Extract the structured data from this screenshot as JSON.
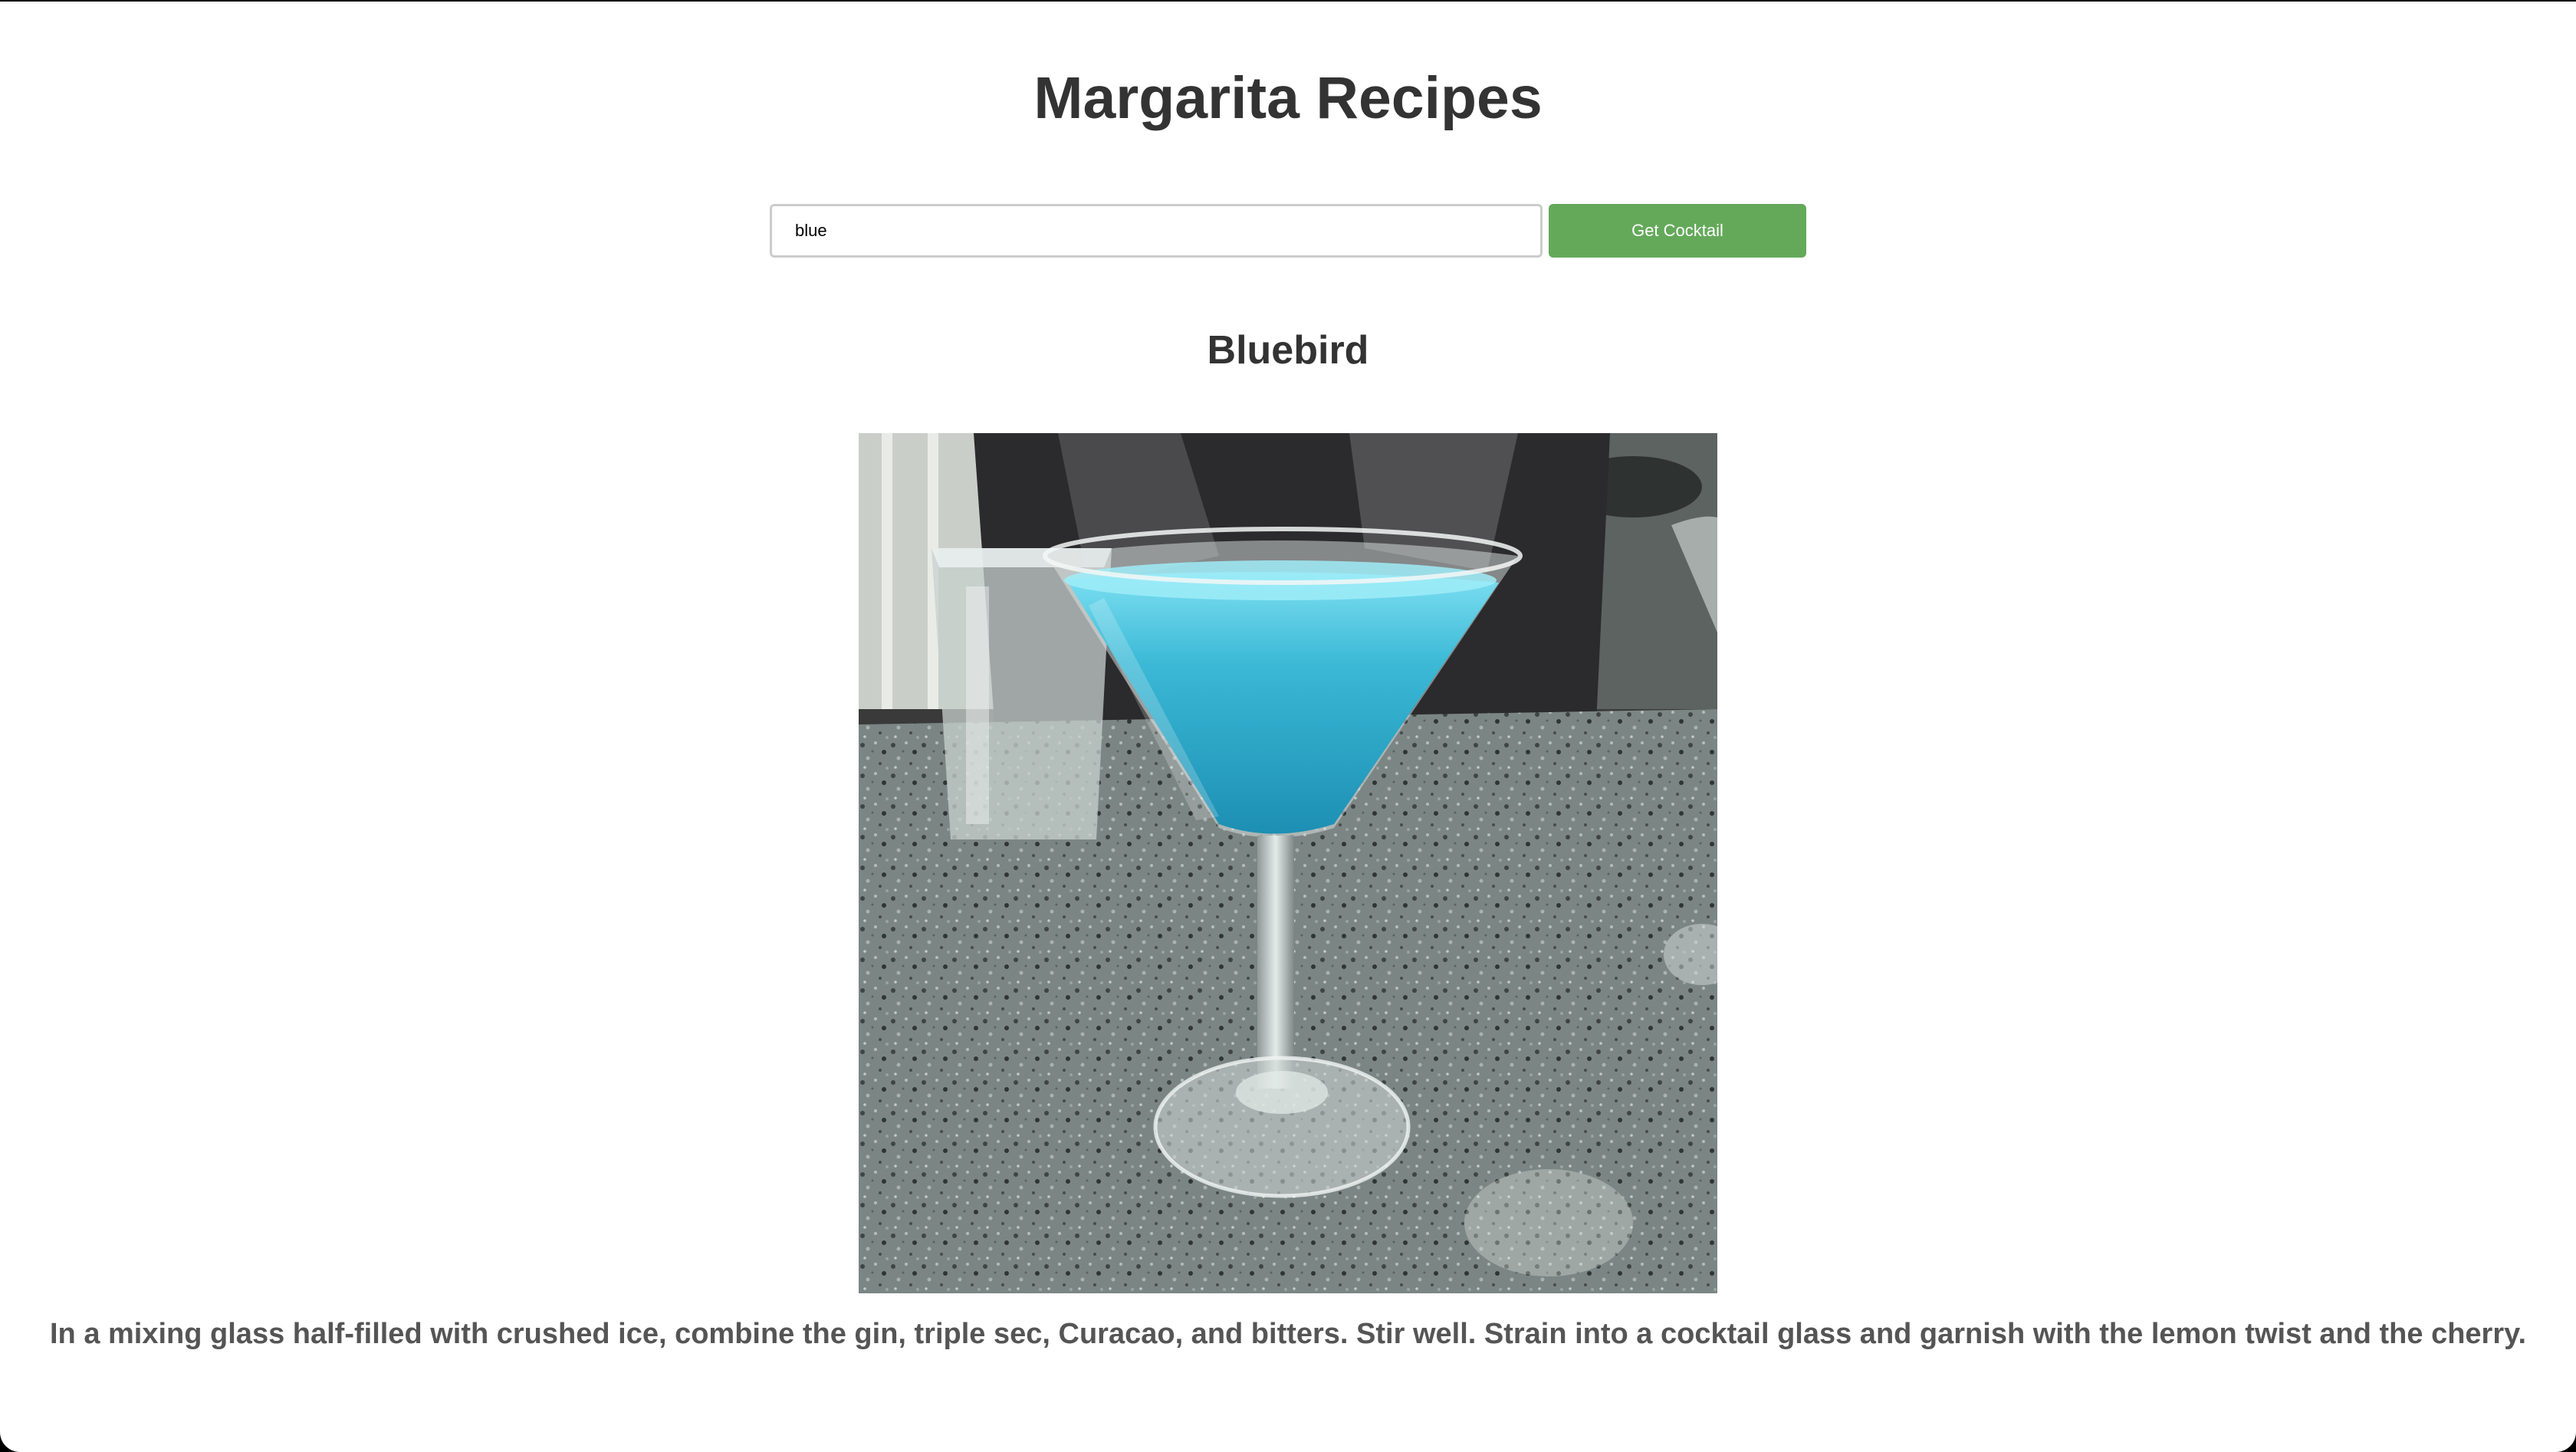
{
  "page": {
    "title": "Margarita Recipes"
  },
  "search": {
    "value": "blue",
    "button_label": "Get Cocktail"
  },
  "drink": {
    "name": "Bluebird",
    "instructions": "In a mixing glass half-filled with crushed ice, combine the gin, triple sec, Curacao, and bitters. Stir well. Strain into a cocktail glass and garnish with the lemon twist and the cherry."
  },
  "colors": {
    "button_bg": "#64a95a",
    "heading_text": "#333333",
    "body_text": "#555555",
    "drink": "#3bb9d6"
  }
}
